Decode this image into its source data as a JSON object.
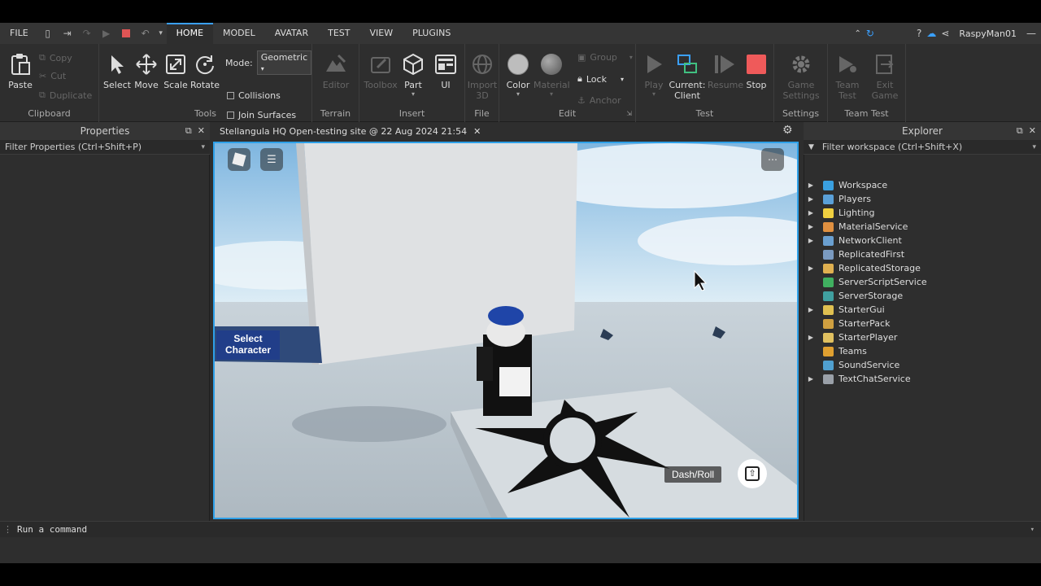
{
  "menu": {
    "file": "FILE",
    "tabs": [
      "HOME",
      "MODEL",
      "AVATAR",
      "TEST",
      "VIEW",
      "PLUGINS"
    ],
    "active_tab": "HOME",
    "user": "RaspyMan01"
  },
  "ribbon": {
    "clipboard": {
      "label": "Clipboard",
      "paste": "Paste",
      "copy": "Copy",
      "cut": "Cut",
      "duplicate": "Duplicate"
    },
    "tools": {
      "label": "Tools",
      "select": "Select",
      "move": "Move",
      "scale": "Scale",
      "rotate": "Rotate",
      "mode_label": "Mode:",
      "mode_value": "Geometric",
      "collisions": "Collisions",
      "join_surfaces": "Join Surfaces"
    },
    "terrain": {
      "label": "Terrain",
      "editor": "Editor"
    },
    "insert": {
      "label": "Insert",
      "toolbox": "Toolbox",
      "part": "Part",
      "ui": "UI"
    },
    "file": {
      "label": "File",
      "import_3d_line1": "Import",
      "import_3d_line2": "3D"
    },
    "edit": {
      "label": "Edit",
      "color": "Color",
      "material": "Material",
      "group": "Group",
      "lock": "Lock",
      "anchor": "Anchor"
    },
    "test": {
      "label": "Test",
      "play": "Play",
      "current_line1": "Current:",
      "current_line2": "Client",
      "resume": "Resume",
      "stop": "Stop"
    },
    "settings": {
      "label": "Settings",
      "game_line1": "Game",
      "game_line2": "Settings"
    },
    "team_test": {
      "label": "Team Test",
      "team_line1": "Team",
      "team_line2": "Test",
      "exit_line1": "Exit",
      "exit_line2": "Game"
    }
  },
  "properties": {
    "title": "Properties",
    "filter": "Filter Properties (Ctrl+Shift+P)"
  },
  "document_tab": {
    "title": "Stellangula HQ Open-testing site @ 22 Aug 2024 21:54"
  },
  "viewport": {
    "select_character_line1": "Select",
    "select_character_line2": "Character",
    "dash_roll": "Dash/Roll"
  },
  "explorer": {
    "title": "Explorer",
    "filter": "Filter workspace (Ctrl+Shift+X)",
    "items": [
      {
        "name": "Workspace",
        "expand": true,
        "color": "#3aa0e0"
      },
      {
        "name": "Players",
        "expand": true,
        "color": "#5aa0d8"
      },
      {
        "name": "Lighting",
        "expand": true,
        "color": "#f0d040"
      },
      {
        "name": "MaterialService",
        "expand": true,
        "color": "#e09040"
      },
      {
        "name": "NetworkClient",
        "expand": true,
        "color": "#6a9fd0"
      },
      {
        "name": "ReplicatedFirst",
        "expand": false,
        "color": "#7a9ac0"
      },
      {
        "name": "ReplicatedStorage",
        "expand": true,
        "color": "#e0b050"
      },
      {
        "name": "ServerScriptService",
        "expand": false,
        "color": "#40b060"
      },
      {
        "name": "ServerStorage",
        "expand": false,
        "color": "#40a0a0"
      },
      {
        "name": "StarterGui",
        "expand": true,
        "color": "#e0c050"
      },
      {
        "name": "StarterPack",
        "expand": false,
        "color": "#d0a040"
      },
      {
        "name": "StarterPlayer",
        "expand": true,
        "color": "#e0c060"
      },
      {
        "name": "Teams",
        "expand": false,
        "color": "#e0a030"
      },
      {
        "name": "SoundService",
        "expand": false,
        "color": "#50a0d0"
      },
      {
        "name": "TextChatService",
        "expand": true,
        "color": "#9aa0a8"
      }
    ]
  },
  "command": {
    "placeholder": "Run a command"
  }
}
